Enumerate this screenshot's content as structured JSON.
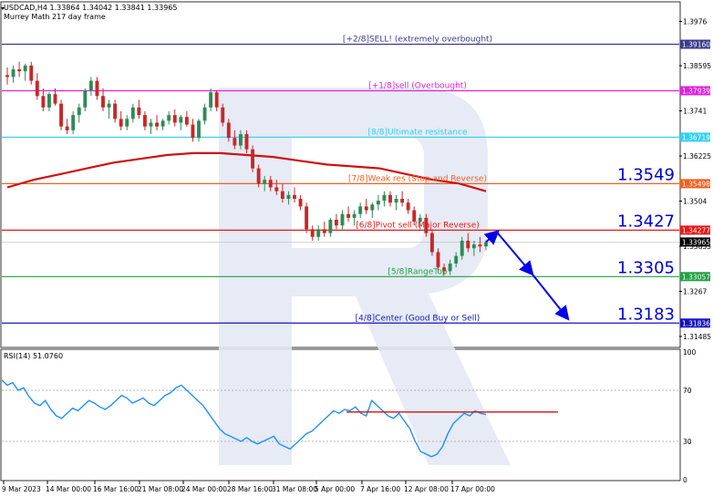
{
  "header": {
    "title": "USDCAD,H4  1.33864 1.34042 1.33841 1.33965",
    "subtitle": "Murrey Math 217 day frame"
  },
  "colors": {
    "bull": "#2e8b57",
    "bear": "#c62828",
    "ma": "#d01010",
    "rsi": "#1e90ff",
    "arrow": "#0000ee",
    "watermark": "#dfe6f3"
  },
  "chart_data": [
    {
      "type": "candlestick",
      "x_ticks": [
        "9 Mar 2023",
        "14 Mar 00:00",
        "16 Mar 16:00",
        "21 Mar 08:00",
        "24 Mar 00:00",
        "28 Mar 16:00",
        "31 Mar 08:00",
        "5 Apr 00:00",
        "7 Apr 16:00",
        "12 Apr 08:00",
        "17 Apr 00:00"
      ],
      "y_ticks": [
        1.3976,
        1.38595,
        1.3741,
        1.36225,
        1.3504,
        1.33855,
        1.3267,
        1.31485
      ],
      "ylim": [
        1.3122,
        1.4025
      ],
      "current_price": 1.33965,
      "current_price_label": "1.33965",
      "levels": [
        {
          "name": "[+2/8]SELL! (extremely overbought)",
          "value": 1.3916,
          "tag": "1.39160",
          "color": "#3a3a8c"
        },
        {
          "name": "[+1/8]sell (Overbought)",
          "value": 1.37939,
          "tag": "1.37939",
          "color": "#e020e0"
        },
        {
          "name": "[8/8]Ultimate resistance",
          "value": 1.36719,
          "tag": "1.36719",
          "color": "#30d0f0"
        },
        {
          "name": "[7/8]Weak res (Stop and Reverse)",
          "value": 1.35498,
          "tag": "1.35498",
          "color": "#f06020"
        },
        {
          "name": "[6/8]Pivot sell (Major Reverse)",
          "value": 1.34277,
          "tag": "1.34277",
          "color": "#e81818"
        },
        {
          "name": "[5/8]RangeTop",
          "value": 1.33057,
          "tag": "1.33057",
          "color": "#22a040"
        },
        {
          "name": "[4/8]Center (Good Buy or Sell)",
          "value": 1.31836,
          "tag": "1.31836",
          "color": "#1515c0"
        }
      ],
      "highlighted_levels": [
        "1.3549",
        "1.3427",
        "1.3305",
        "1.3183"
      ],
      "candles": [
        [
          1.3835,
          1.3855,
          1.381,
          1.383
        ],
        [
          1.383,
          1.386,
          1.3815,
          1.385
        ],
        [
          1.385,
          1.387,
          1.383,
          1.3845
        ],
        [
          1.3845,
          1.3865,
          1.382,
          1.386
        ],
        [
          1.386,
          1.387,
          1.381,
          1.382
        ],
        [
          1.382,
          1.384,
          1.377,
          1.378
        ],
        [
          1.378,
          1.38,
          1.374,
          1.375
        ],
        [
          1.375,
          1.379,
          1.374,
          1.3785
        ],
        [
          1.3785,
          1.38,
          1.3755,
          1.376
        ],
        [
          1.376,
          1.377,
          1.369,
          1.37
        ],
        [
          1.37,
          1.372,
          1.368,
          1.369
        ],
        [
          1.369,
          1.374,
          1.368,
          1.373
        ],
        [
          1.373,
          1.376,
          1.371,
          1.375
        ],
        [
          1.375,
          1.38,
          1.374,
          1.3795
        ],
        [
          1.3795,
          1.383,
          1.378,
          1.382
        ],
        [
          1.382,
          1.383,
          1.377,
          1.378
        ],
        [
          1.378,
          1.38,
          1.374,
          1.375
        ],
        [
          1.375,
          1.377,
          1.372,
          1.376
        ],
        [
          1.376,
          1.377,
          1.371,
          1.372
        ],
        [
          1.372,
          1.374,
          1.369,
          1.37
        ],
        [
          1.37,
          1.373,
          1.369,
          1.372
        ],
        [
          1.372,
          1.376,
          1.371,
          1.375
        ],
        [
          1.375,
          1.377,
          1.372,
          1.373
        ],
        [
          1.373,
          1.374,
          1.369,
          1.37
        ],
        [
          1.37,
          1.372,
          1.368,
          1.371
        ],
        [
          1.371,
          1.373,
          1.369,
          1.37
        ],
        [
          1.37,
          1.372,
          1.369,
          1.3715
        ],
        [
          1.3715,
          1.374,
          1.3705,
          1.373
        ],
        [
          1.373,
          1.3745,
          1.37,
          1.371
        ],
        [
          1.371,
          1.373,
          1.369,
          1.3725
        ],
        [
          1.3725,
          1.374,
          1.37,
          1.3705
        ],
        [
          1.3705,
          1.372,
          1.366,
          1.367
        ],
        [
          1.367,
          1.372,
          1.366,
          1.3715
        ],
        [
          1.3715,
          1.376,
          1.3705,
          1.375
        ],
        [
          1.375,
          1.38,
          1.374,
          1.379
        ],
        [
          1.379,
          1.3795,
          1.374,
          1.375
        ],
        [
          1.375,
          1.376,
          1.37,
          1.371
        ],
        [
          1.371,
          1.372,
          1.366,
          1.367
        ],
        [
          1.367,
          1.369,
          1.364,
          1.365
        ],
        [
          1.365,
          1.369,
          1.364,
          1.368
        ],
        [
          1.368,
          1.369,
          1.363,
          1.364
        ],
        [
          1.364,
          1.365,
          1.358,
          1.359
        ],
        [
          1.359,
          1.36,
          1.354,
          1.355
        ],
        [
          1.355,
          1.357,
          1.353,
          1.356
        ],
        [
          1.356,
          1.357,
          1.353,
          1.354
        ],
        [
          1.354,
          1.356,
          1.352,
          1.353
        ],
        [
          1.353,
          1.355,
          1.35,
          1.351
        ],
        [
          1.351,
          1.353,
          1.3495,
          1.352
        ],
        [
          1.352,
          1.354,
          1.35,
          1.351
        ],
        [
          1.351,
          1.352,
          1.348,
          1.349
        ],
        [
          1.349,
          1.35,
          1.342,
          1.343
        ],
        [
          1.343,
          1.344,
          1.34,
          1.341
        ],
        [
          1.341,
          1.344,
          1.34,
          1.343
        ],
        [
          1.343,
          1.345,
          1.341,
          1.342
        ],
        [
          1.342,
          1.346,
          1.341,
          1.3455
        ],
        [
          1.3455,
          1.347,
          1.343,
          1.344
        ],
        [
          1.344,
          1.348,
          1.343,
          1.347
        ],
        [
          1.347,
          1.349,
          1.345,
          1.346
        ],
        [
          1.346,
          1.348,
          1.344,
          1.347
        ],
        [
          1.347,
          1.35,
          1.346,
          1.349
        ],
        [
          1.349,
          1.351,
          1.347,
          1.348
        ],
        [
          1.348,
          1.35,
          1.346,
          1.3495
        ],
        [
          1.3495,
          1.352,
          1.348,
          1.3505
        ],
        [
          1.3505,
          1.353,
          1.349,
          1.352
        ],
        [
          1.352,
          1.353,
          1.349,
          1.35
        ],
        [
          1.35,
          1.352,
          1.348,
          1.351
        ],
        [
          1.351,
          1.353,
          1.349,
          1.35
        ],
        [
          1.35,
          1.351,
          1.347,
          1.348
        ],
        [
          1.348,
          1.349,
          1.344,
          1.345
        ],
        [
          1.345,
          1.347,
          1.343,
          1.346
        ],
        [
          1.346,
          1.347,
          1.341,
          1.342
        ],
        [
          1.342,
          1.343,
          1.336,
          1.337
        ],
        [
          1.337,
          1.338,
          1.332,
          1.333
        ],
        [
          1.333,
          1.334,
          1.331,
          1.332
        ],
        [
          1.332,
          1.335,
          1.331,
          1.334
        ],
        [
          1.334,
          1.337,
          1.333,
          1.336
        ],
        [
          1.336,
          1.341,
          1.335,
          1.34
        ],
        [
          1.34,
          1.342,
          1.337,
          1.338
        ],
        [
          1.338,
          1.34,
          1.336,
          1.339
        ],
        [
          1.339,
          1.341,
          1.337,
          1.3385
        ],
        [
          1.3385,
          1.34,
          1.3375,
          1.3396
        ]
      ],
      "moving_average": [
        1.354,
        1.356,
        1.3575,
        1.359,
        1.3605,
        1.3615,
        1.3625,
        1.363,
        1.363,
        1.3625,
        1.362,
        1.361,
        1.36,
        1.3595,
        1.359,
        1.3575,
        1.356,
        1.355,
        1.353
      ],
      "forecast_path": [
        {
          "x": "17 Apr 00:00",
          "y": 1.3427
        },
        {
          "x": "",
          "y": 1.3305
        },
        {
          "x": "",
          "y": 1.3183
        }
      ]
    },
    {
      "type": "line",
      "title": "RSI(14) 51.0760",
      "y_ticks": [
        100,
        70,
        30,
        0
      ],
      "ylim": [
        0,
        100
      ],
      "reference_level": 53,
      "values": [
        78,
        74,
        76,
        70,
        72,
        65,
        60,
        58,
        62,
        55,
        50,
        48,
        52,
        56,
        54,
        58,
        62,
        60,
        57,
        55,
        58,
        62,
        66,
        64,
        60,
        62,
        64,
        60,
        58,
        62,
        66,
        68,
        72,
        74,
        70,
        66,
        62,
        58,
        52,
        46,
        40,
        36,
        34,
        32,
        30,
        33,
        30,
        28,
        30,
        32,
        34,
        28,
        26,
        24,
        28,
        32,
        36,
        38,
        42,
        46,
        50,
        54,
        52,
        55,
        54,
        57,
        52,
        50,
        62,
        58,
        54,
        50,
        48,
        52,
        46,
        40,
        30,
        22,
        20,
        18,
        20,
        26,
        36,
        44,
        48,
        52,
        50,
        54,
        52,
        51
      ]
    }
  ]
}
